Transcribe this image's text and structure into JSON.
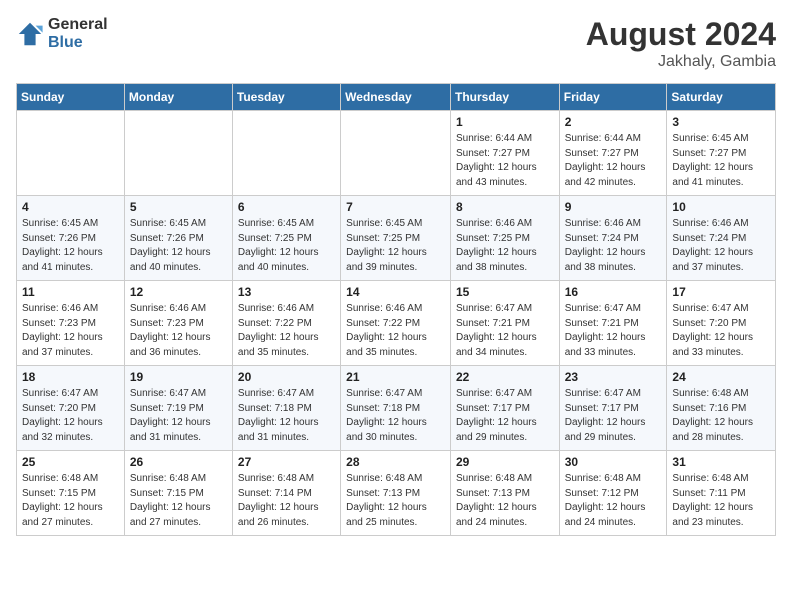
{
  "logo": {
    "general": "General",
    "blue": "Blue"
  },
  "title": {
    "month_year": "August 2024",
    "location": "Jakhaly, Gambia"
  },
  "headers": [
    "Sunday",
    "Monday",
    "Tuesday",
    "Wednesday",
    "Thursday",
    "Friday",
    "Saturday"
  ],
  "weeks": [
    [
      {
        "day": "",
        "info": ""
      },
      {
        "day": "",
        "info": ""
      },
      {
        "day": "",
        "info": ""
      },
      {
        "day": "",
        "info": ""
      },
      {
        "day": "1",
        "info": "Sunrise: 6:44 AM\nSunset: 7:27 PM\nDaylight: 12 hours\nand 43 minutes."
      },
      {
        "day": "2",
        "info": "Sunrise: 6:44 AM\nSunset: 7:27 PM\nDaylight: 12 hours\nand 42 minutes."
      },
      {
        "day": "3",
        "info": "Sunrise: 6:45 AM\nSunset: 7:27 PM\nDaylight: 12 hours\nand 41 minutes."
      }
    ],
    [
      {
        "day": "4",
        "info": "Sunrise: 6:45 AM\nSunset: 7:26 PM\nDaylight: 12 hours\nand 41 minutes."
      },
      {
        "day": "5",
        "info": "Sunrise: 6:45 AM\nSunset: 7:26 PM\nDaylight: 12 hours\nand 40 minutes."
      },
      {
        "day": "6",
        "info": "Sunrise: 6:45 AM\nSunset: 7:25 PM\nDaylight: 12 hours\nand 40 minutes."
      },
      {
        "day": "7",
        "info": "Sunrise: 6:45 AM\nSunset: 7:25 PM\nDaylight: 12 hours\nand 39 minutes."
      },
      {
        "day": "8",
        "info": "Sunrise: 6:46 AM\nSunset: 7:25 PM\nDaylight: 12 hours\nand 38 minutes."
      },
      {
        "day": "9",
        "info": "Sunrise: 6:46 AM\nSunset: 7:24 PM\nDaylight: 12 hours\nand 38 minutes."
      },
      {
        "day": "10",
        "info": "Sunrise: 6:46 AM\nSunset: 7:24 PM\nDaylight: 12 hours\nand 37 minutes."
      }
    ],
    [
      {
        "day": "11",
        "info": "Sunrise: 6:46 AM\nSunset: 7:23 PM\nDaylight: 12 hours\nand 37 minutes."
      },
      {
        "day": "12",
        "info": "Sunrise: 6:46 AM\nSunset: 7:23 PM\nDaylight: 12 hours\nand 36 minutes."
      },
      {
        "day": "13",
        "info": "Sunrise: 6:46 AM\nSunset: 7:22 PM\nDaylight: 12 hours\nand 35 minutes."
      },
      {
        "day": "14",
        "info": "Sunrise: 6:46 AM\nSunset: 7:22 PM\nDaylight: 12 hours\nand 35 minutes."
      },
      {
        "day": "15",
        "info": "Sunrise: 6:47 AM\nSunset: 7:21 PM\nDaylight: 12 hours\nand 34 minutes."
      },
      {
        "day": "16",
        "info": "Sunrise: 6:47 AM\nSunset: 7:21 PM\nDaylight: 12 hours\nand 33 minutes."
      },
      {
        "day": "17",
        "info": "Sunrise: 6:47 AM\nSunset: 7:20 PM\nDaylight: 12 hours\nand 33 minutes."
      }
    ],
    [
      {
        "day": "18",
        "info": "Sunrise: 6:47 AM\nSunset: 7:20 PM\nDaylight: 12 hours\nand 32 minutes."
      },
      {
        "day": "19",
        "info": "Sunrise: 6:47 AM\nSunset: 7:19 PM\nDaylight: 12 hours\nand 31 minutes."
      },
      {
        "day": "20",
        "info": "Sunrise: 6:47 AM\nSunset: 7:18 PM\nDaylight: 12 hours\nand 31 minutes."
      },
      {
        "day": "21",
        "info": "Sunrise: 6:47 AM\nSunset: 7:18 PM\nDaylight: 12 hours\nand 30 minutes."
      },
      {
        "day": "22",
        "info": "Sunrise: 6:47 AM\nSunset: 7:17 PM\nDaylight: 12 hours\nand 29 minutes."
      },
      {
        "day": "23",
        "info": "Sunrise: 6:47 AM\nSunset: 7:17 PM\nDaylight: 12 hours\nand 29 minutes."
      },
      {
        "day": "24",
        "info": "Sunrise: 6:48 AM\nSunset: 7:16 PM\nDaylight: 12 hours\nand 28 minutes."
      }
    ],
    [
      {
        "day": "25",
        "info": "Sunrise: 6:48 AM\nSunset: 7:15 PM\nDaylight: 12 hours\nand 27 minutes."
      },
      {
        "day": "26",
        "info": "Sunrise: 6:48 AM\nSunset: 7:15 PM\nDaylight: 12 hours\nand 27 minutes."
      },
      {
        "day": "27",
        "info": "Sunrise: 6:48 AM\nSunset: 7:14 PM\nDaylight: 12 hours\nand 26 minutes."
      },
      {
        "day": "28",
        "info": "Sunrise: 6:48 AM\nSunset: 7:13 PM\nDaylight: 12 hours\nand 25 minutes."
      },
      {
        "day": "29",
        "info": "Sunrise: 6:48 AM\nSunset: 7:13 PM\nDaylight: 12 hours\nand 24 minutes."
      },
      {
        "day": "30",
        "info": "Sunrise: 6:48 AM\nSunset: 7:12 PM\nDaylight: 12 hours\nand 24 minutes."
      },
      {
        "day": "31",
        "info": "Sunrise: 6:48 AM\nSunset: 7:11 PM\nDaylight: 12 hours\nand 23 minutes."
      }
    ]
  ]
}
